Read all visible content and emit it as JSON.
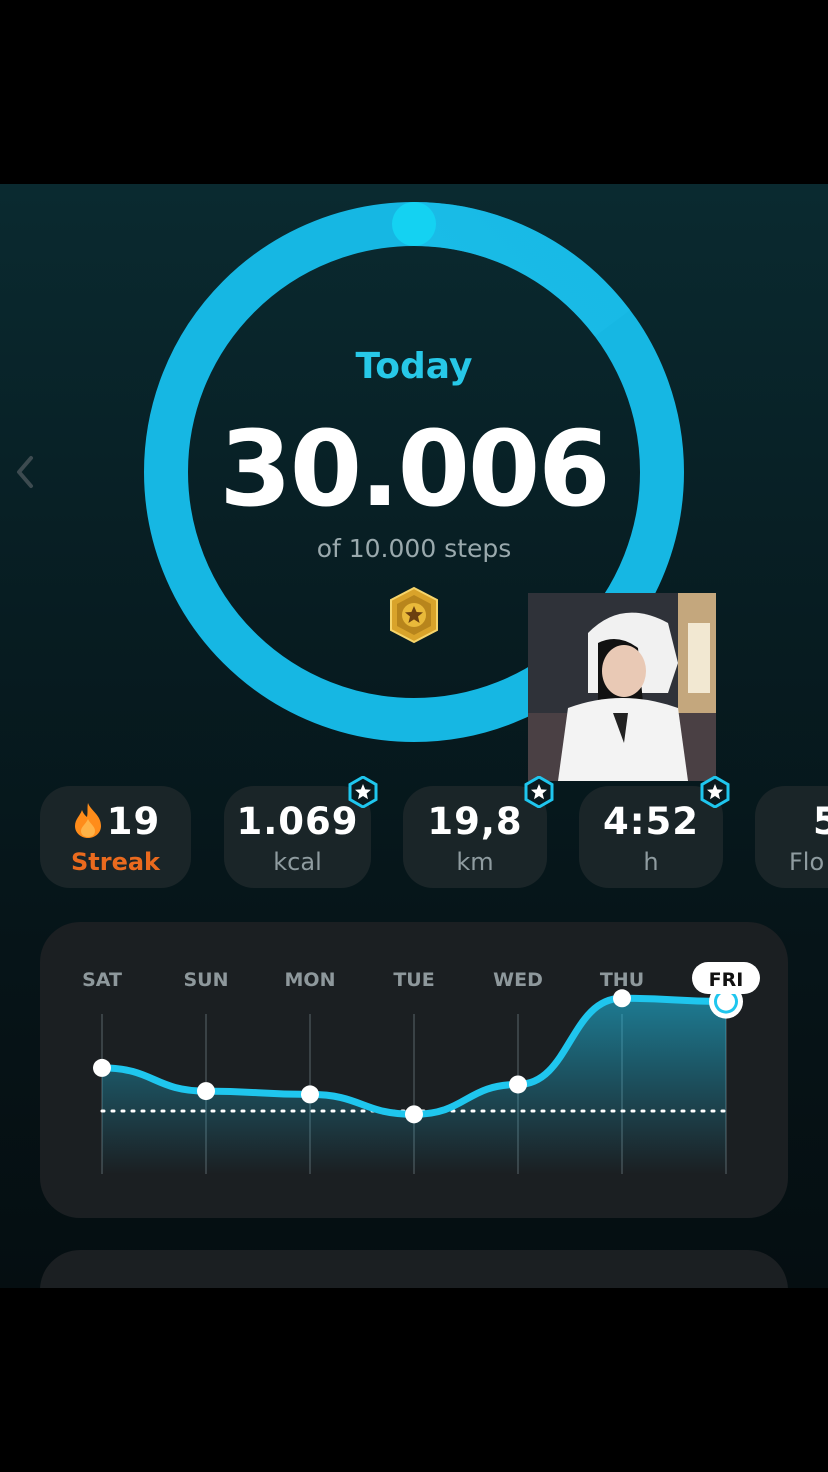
{
  "colors": {
    "accent": "#1fc6ee",
    "accent_light": "#7ae4f6",
    "streak": "#ea6a1e",
    "card": "#1a2528"
  },
  "header": {
    "title": "Today"
  },
  "steps": {
    "value": "30.006",
    "goal_text": "of 10.000 steps",
    "progress": 3.0006
  },
  "icons": {
    "back": "chevron-left-icon",
    "medal": "medal-star-icon",
    "flame": "flame-icon",
    "badge": "star-badge-icon"
  },
  "stats": [
    {
      "value": "19",
      "unit": "Streak",
      "icon": "flame-icon",
      "badge": false
    },
    {
      "value": "1.069",
      "unit": "kcal",
      "badge": true
    },
    {
      "value": "19,8",
      "unit": "km",
      "badge": true
    },
    {
      "value": "4:52",
      "unit": "h",
      "badge": true
    },
    {
      "value": "5",
      "unit": "Flo",
      "badge": false
    }
  ],
  "chart_data": {
    "type": "line",
    "categories": [
      "SAT",
      "SUN",
      "MON",
      "TUE",
      "WED",
      "THU",
      "FRI"
    ],
    "series": [
      {
        "values": [
          16000,
          12500,
          12000,
          9000,
          13500,
          26500,
          26000
        ]
      }
    ],
    "reference_line": 9500,
    "selected": "FRI",
    "ylim": [
      0,
      38000
    ],
    "grid": false
  }
}
